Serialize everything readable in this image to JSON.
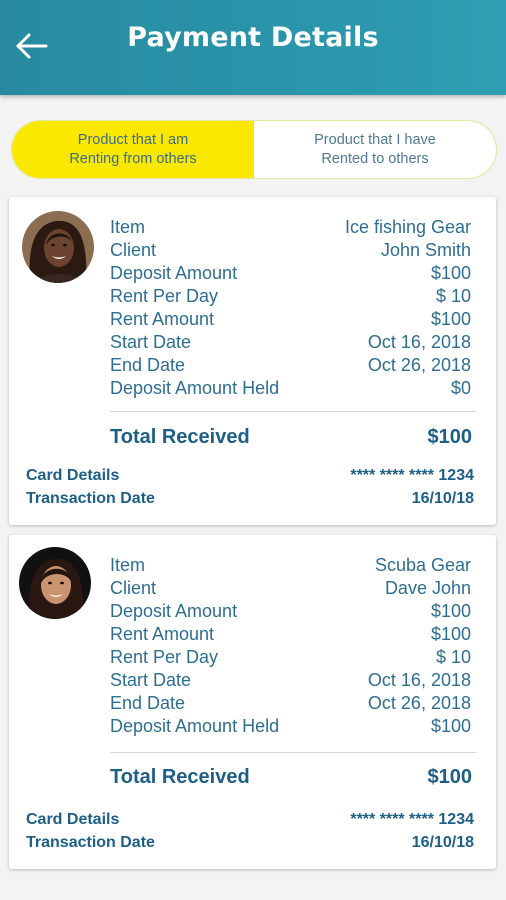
{
  "header": {
    "title": "Payment Details",
    "back_icon": "arrow-left-icon"
  },
  "tabs": [
    {
      "label": "Product that I am\nRenting from others",
      "active": true
    },
    {
      "label": "Product that I have\nRented to others",
      "active": false
    }
  ],
  "colors": {
    "header": "#2a95ab",
    "active_tab": "#fbe800",
    "text": "#2e6e92"
  },
  "payments": [
    {
      "details": [
        {
          "label": "Item",
          "value": "Ice fishing Gear"
        },
        {
          "label": "Client",
          "value": "John Smith"
        },
        {
          "label": "Deposit Amount",
          "value": "$100"
        },
        {
          "label": "Rent Per Day",
          "value": "$ 10"
        },
        {
          "label": "Rent Amount",
          "value": "$100"
        },
        {
          "label": "Start Date",
          "value": "Oct 16, 2018"
        },
        {
          "label": "End Date",
          "value": "Oct 26, 2018"
        },
        {
          "label": "Deposit Amount Held",
          "value": "$0"
        }
      ],
      "total_label": "Total Received",
      "total_value": "$100",
      "card_label": "Card Details",
      "card_value": "**** **** **** 1234",
      "date_label": "Transaction Date",
      "date_value": "16/10/18"
    },
    {
      "details": [
        {
          "label": "Item",
          "value": "Scuba Gear"
        },
        {
          "label": "Client",
          "value": "Dave John"
        },
        {
          "label": "Deposit Amount",
          "value": "$100"
        },
        {
          "label": "Rent Amount",
          "value": "$100"
        },
        {
          "label": "Rent Per Day",
          "value": "$ 10"
        },
        {
          "label": "Start Date",
          "value": "Oct 16, 2018"
        },
        {
          "label": "End Date",
          "value": "Oct 26, 2018"
        },
        {
          "label": "Deposit Amount Held",
          "value": "$100"
        }
      ],
      "total_label": "Total Received",
      "total_value": "$100",
      "card_label": "Card Details",
      "card_value": "**** **** **** 1234",
      "date_label": "Transaction Date",
      "date_value": "16/10/18"
    }
  ]
}
